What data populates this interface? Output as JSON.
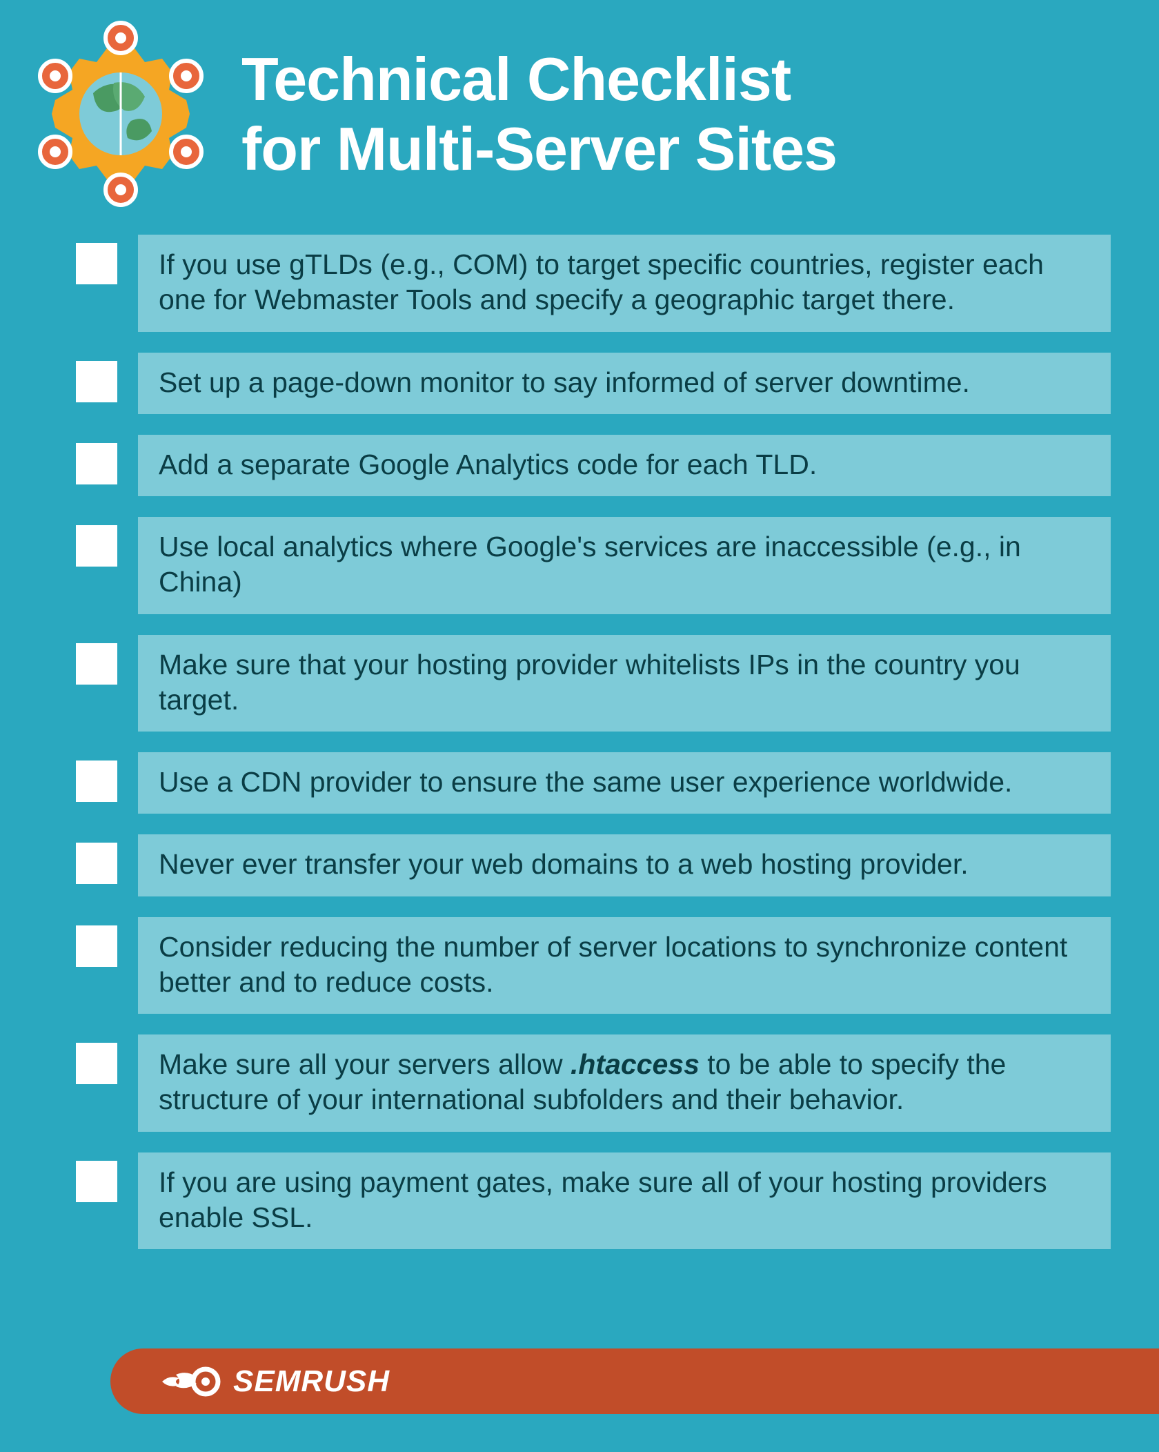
{
  "title_line1": "Technical Checklist",
  "title_line2": "for Multi-Server Sites",
  "items": [
    "If you use gTLDs (e.g., COM) to target specific countries, register each one for Webmaster Tools and specify a geographic target there.",
    "Set up a page-down monitor to say informed of server downtime.",
    "Add a separate Google Analytics code for each TLD.",
    "Use local analytics where Google's services are inaccessible (e.g., in China)",
    "Make sure that your hosting provider whitelists IPs in the country you target.",
    "Use a CDN provider to ensure the same user experience worldwide.",
    "Never ever transfer your web domains to a web hosting provider.",
    "Consider reducing the number of server locations to synchronize content better and to reduce costs.",
    "Make sure all your servers allow <em>.htaccess</em> to be able to specify the structure of your international subfolders and their behavior.",
    "If you are using payment gates, make sure all of your hosting providers enable SSL."
  ],
  "brand": "SEMRUSH"
}
